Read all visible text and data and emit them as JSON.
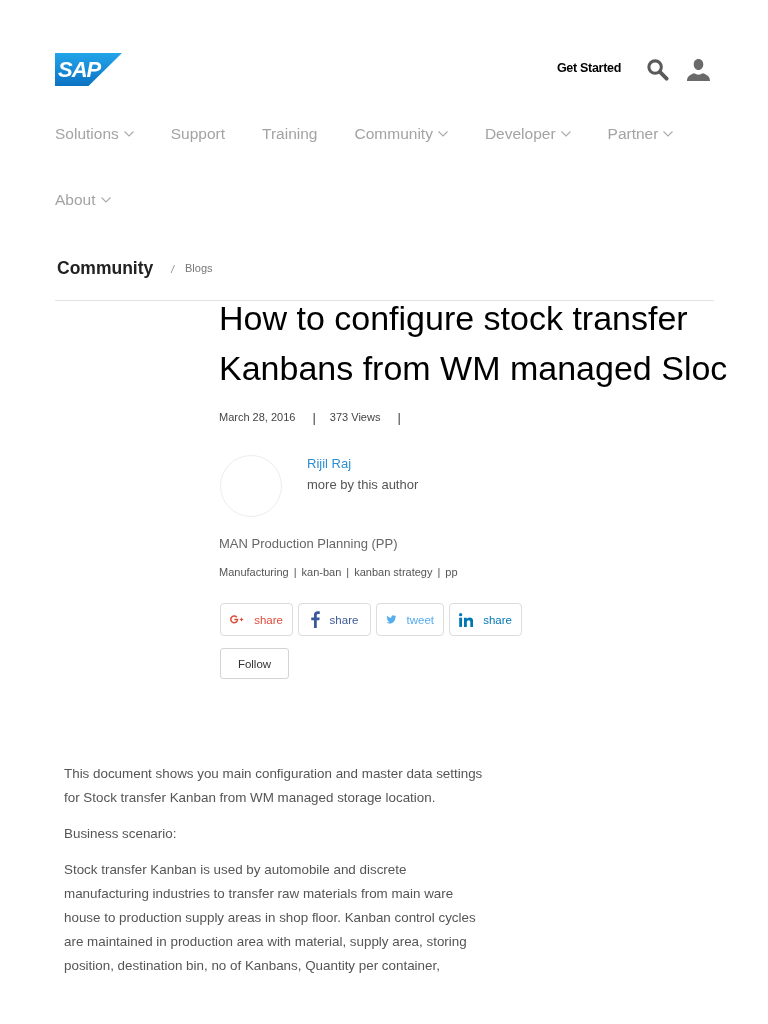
{
  "header": {
    "logo": "SAP",
    "get_started": "Get Started"
  },
  "nav": [
    {
      "label": "Solutions",
      "dropdown": true
    },
    {
      "label": "Support",
      "dropdown": false
    },
    {
      "label": "Training",
      "dropdown": false
    },
    {
      "label": "Community",
      "dropdown": true
    },
    {
      "label": "Developer",
      "dropdown": true
    },
    {
      "label": "Partner",
      "dropdown": true
    },
    {
      "label": "About",
      "dropdown": true
    }
  ],
  "breadcrumb": {
    "items": [
      "Community",
      "Blogs"
    ],
    "separator": "/"
  },
  "article": {
    "title": "How to configure stock transfer Kanbans from WM managed Sloc",
    "meta": [
      "March 28, 2016",
      "373 Views"
    ],
    "separator": "|"
  },
  "author": {
    "name": "Rijil Raj",
    "more": "more by this author"
  },
  "category": "MAN Production Planning (PP)",
  "tags": {
    "items": [
      "Manufacturing",
      "kan-ban",
      "kanban strategy",
      "pp"
    ],
    "separator": "|"
  },
  "share_buttons": [
    {
      "kind": "google-plus",
      "label": "share",
      "color": "#dd4b39"
    },
    {
      "kind": "facebook",
      "label": "share",
      "color": "#3b5998"
    },
    {
      "kind": "twitter",
      "label": "tweet",
      "color": "#55acee"
    },
    {
      "kind": "linkedin",
      "label": "share",
      "color": "#0077b5"
    }
  ],
  "follow_button": "Follow",
  "body": [
    "This document shows you main configuration and master data settings for Stock transfer Kanban from WM managed storage location.",
    "Business scenario:",
    "Stock transfer Kanban is used by automobile and discrete manufacturing industries to transfer raw materials from main ware house to production supply areas in shop floor. Kanban control cycles are maintained in production area with material, supply area, storing position, destination bin, no of Kanbans, Quantity per container,"
  ]
}
